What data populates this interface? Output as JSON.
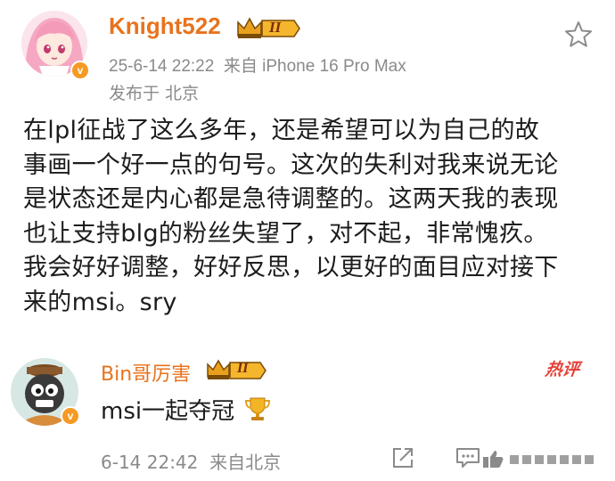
{
  "post": {
    "author": "Knight522",
    "level": "II",
    "time_source": "25-6-14 22:22  来自 iPhone 16 Pro Max",
    "location": "发布于 北京",
    "lines": [
      "在lpl征战了这么多年，还是希望可以为自己的故",
      "事画一个好一点的句号。这次的失利对我来说无论",
      "是状态还是内心都是急待调整的。这两天我的表现",
      "也让支持blg的粉丝失望了，对不起，非常愧疚。",
      "我会好好调整，好好反思，以更好的面目应对接下",
      "来的msi。sry"
    ]
  },
  "comment": {
    "author": "Bin哥厉害",
    "level": "II",
    "text": "msi一起夺冠",
    "hot_label": "热评",
    "time_source": "6-14 22:42  来自北京"
  },
  "badges": {
    "verified": "v"
  },
  "icons": {
    "favorite": "star-outline-icon",
    "crown": "crown-icon",
    "trophy": "trophy-icon",
    "share": "share-icon",
    "comment": "comment-icon",
    "like": "like-icon"
  },
  "colors": {
    "username": "#e8731d",
    "hot": "#e6423a",
    "verified": "#f59a23",
    "meta": "#8a8a8a"
  }
}
